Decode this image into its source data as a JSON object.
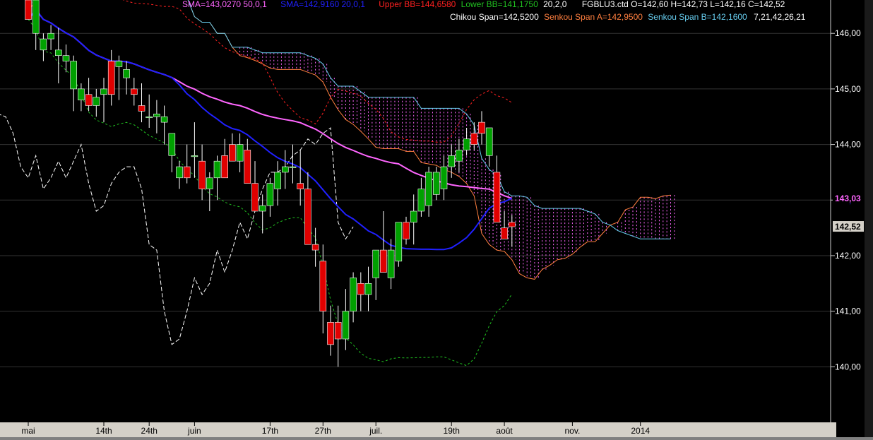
{
  "chart_data": {
    "type": "candlestick",
    "y_ticks": [
      "146,00",
      "145,00",
      "144,00",
      "143,00",
      "142,00",
      "141,00",
      "140,00"
    ],
    "y_tick_values": [
      146,
      145,
      144,
      143,
      142,
      141,
      140
    ],
    "ylim": [
      139.0,
      146.6
    ],
    "x_tick_labels": [
      "mai",
      "14th",
      "24th",
      "juin",
      "17th",
      "27th",
      "juil.",
      "19th",
      "août",
      "nov.",
      "2014"
    ],
    "x_tick_positions": [
      0,
      10,
      16,
      22,
      32,
      39,
      46,
      56,
      63,
      72,
      81
    ],
    "price_labels": {
      "sma50": "143,03",
      "sma20": "143,00",
      "last": "142,52"
    },
    "legend": {
      "sma50": "SMA=143,0270  50,0,1",
      "sma20": "SMA=142,9160  20,0,1",
      "upper_bb": "Upper BB=144,6580",
      "lower_bb": "Lower BB=141,1750",
      "bb_params": "20,2,0",
      "ohlc": "FGBLU3.ctd O=142,60 H=142,73 L=142,16 C=142,52",
      "chikou": "Chikou Span=142,5200",
      "senkou_a": "Senkou Span A=142,9500",
      "senkou_b": "Senkou Span B=142,1600",
      "ichimoku_params": "7,21,42,26,21"
    },
    "colors": {
      "up": "#00a000",
      "down": "#e00000",
      "sma50": "#ff66ff",
      "sma20": "#2020ff",
      "upper_bb": "#ff2020",
      "lower_bb": "#20c020",
      "chikou": "#ffffff",
      "senkou_a": "#ff7f3f",
      "senkou_b": "#66ccee",
      "cloud": "#ff66ff"
    },
    "candles": [
      [
        146.6,
        146.9,
        146.4,
        146.25
      ],
      [
        146.0,
        146.3,
        145.7,
        146.6
      ],
      [
        145.7,
        146.0,
        145.5,
        145.9
      ],
      [
        145.9,
        146.15,
        145.7,
        146.0
      ],
      [
        145.6,
        146.1,
        145.1,
        145.7
      ],
      [
        145.5,
        145.8,
        145.3,
        145.6
      ],
      [
        145.0,
        145.6,
        144.6,
        145.5
      ],
      [
        144.8,
        145.1,
        144.6,
        145.0
      ],
      [
        144.9,
        145.2,
        144.6,
        144.7
      ],
      [
        144.7,
        145.0,
        144.5,
        144.85
      ],
      [
        144.9,
        145.2,
        144.4,
        145.0
      ],
      [
        145.5,
        145.7,
        144.7,
        144.9
      ],
      [
        145.4,
        145.6,
        144.8,
        145.5
      ],
      [
        145.2,
        145.5,
        144.9,
        145.35
      ],
      [
        145.0,
        145.2,
        144.7,
        144.9
      ],
      [
        144.7,
        145.1,
        144.4,
        144.6
      ],
      [
        144.5,
        144.9,
        144.3,
        144.5
      ],
      [
        144.5,
        144.8,
        144.2,
        144.55
      ],
      [
        144.4,
        144.7,
        144.0,
        144.5
      ],
      [
        143.8,
        144.2,
        143.5,
        144.2
      ],
      [
        143.4,
        143.7,
        143.2,
        143.6
      ],
      [
        143.6,
        144.0,
        143.3,
        143.4
      ],
      [
        143.8,
        144.4,
        143.4,
        143.8
      ],
      [
        143.7,
        144.0,
        143.0,
        143.2
      ],
      [
        143.2,
        143.5,
        142.8,
        143.4
      ],
      [
        143.4,
        143.8,
        143.0,
        143.7
      ],
      [
        143.8,
        144.1,
        143.4,
        143.4
      ],
      [
        144.0,
        144.2,
        143.7,
        143.7
      ],
      [
        143.7,
        144.2,
        143.5,
        144.0
      ],
      [
        143.9,
        144.1,
        143.4,
        143.3
      ],
      [
        143.3,
        143.7,
        142.8,
        142.8
      ],
      [
        142.8,
        143.1,
        142.4,
        142.9
      ],
      [
        142.9,
        143.4,
        142.7,
        143.3
      ],
      [
        143.2,
        143.7,
        142.9,
        143.5
      ],
      [
        143.5,
        143.9,
        143.2,
        143.6
      ],
      [
        143.6,
        144.0,
        143.3,
        143.6
      ],
      [
        143.3,
        143.9,
        142.9,
        143.2
      ],
      [
        143.2,
        143.5,
        142.2,
        142.2
      ],
      [
        142.2,
        142.5,
        141.8,
        142.1
      ],
      [
        141.9,
        142.2,
        140.6,
        141.0
      ],
      [
        140.8,
        141.1,
        140.2,
        140.4
      ],
      [
        140.8,
        141.1,
        140.0,
        140.5
      ],
      [
        140.5,
        141.4,
        140.3,
        141.0
      ],
      [
        141.0,
        141.7,
        140.8,
        141.6
      ],
      [
        141.5,
        141.7,
        141.0,
        141.3
      ],
      [
        141.3,
        141.8,
        141.0,
        141.5
      ],
      [
        141.6,
        142.1,
        141.2,
        142.1
      ],
      [
        142.1,
        142.8,
        141.8,
        141.7
      ],
      [
        141.6,
        142.3,
        141.4,
        142.1
      ],
      [
        141.9,
        142.5,
        141.8,
        142.6
      ],
      [
        142.6,
        142.7,
        142.2,
        142.3
      ],
      [
        142.6,
        143.1,
        142.2,
        142.8
      ],
      [
        142.8,
        143.4,
        142.7,
        143.2
      ],
      [
        142.9,
        143.6,
        142.7,
        143.5
      ],
      [
        143.1,
        143.6,
        143.0,
        143.5
      ],
      [
        143.2,
        143.8,
        143.0,
        143.6
      ],
      [
        143.6,
        144.0,
        143.4,
        143.8
      ],
      [
        143.7,
        144.1,
        143.5,
        143.9
      ],
      [
        143.9,
        144.3,
        143.8,
        144.1
      ],
      [
        144.2,
        144.4,
        143.9,
        144.0
      ],
      [
        144.4,
        144.6,
        144.0,
        144.2
      ],
      [
        143.8,
        144.2,
        143.6,
        144.3
      ],
      [
        143.5,
        143.8,
        142.6,
        142.6
      ],
      [
        142.5,
        142.8,
        142.3,
        142.3
      ],
      [
        142.6,
        142.73,
        142.16,
        142.52
      ]
    ]
  }
}
